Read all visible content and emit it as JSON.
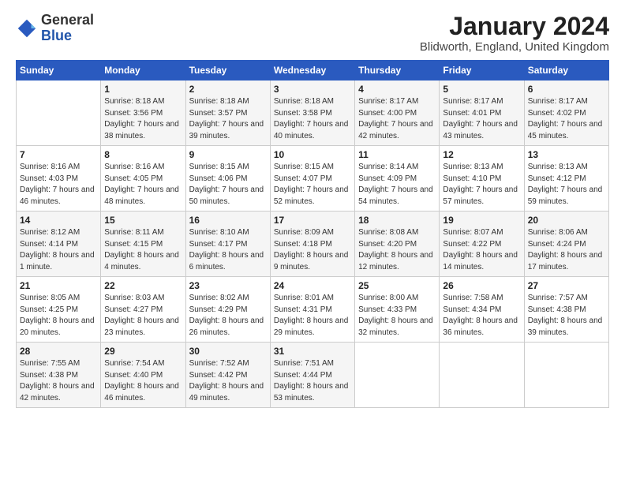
{
  "logo": {
    "text_general": "General",
    "text_blue": "Blue"
  },
  "header": {
    "month_title": "January 2024",
    "location": "Blidworth, England, United Kingdom"
  },
  "days_of_week": [
    "Sunday",
    "Monday",
    "Tuesday",
    "Wednesday",
    "Thursday",
    "Friday",
    "Saturday"
  ],
  "weeks": [
    [
      {
        "day": "",
        "sunrise": "",
        "sunset": "",
        "daylight": ""
      },
      {
        "day": "1",
        "sunrise": "Sunrise: 8:18 AM",
        "sunset": "Sunset: 3:56 PM",
        "daylight": "Daylight: 7 hours and 38 minutes."
      },
      {
        "day": "2",
        "sunrise": "Sunrise: 8:18 AM",
        "sunset": "Sunset: 3:57 PM",
        "daylight": "Daylight: 7 hours and 39 minutes."
      },
      {
        "day": "3",
        "sunrise": "Sunrise: 8:18 AM",
        "sunset": "Sunset: 3:58 PM",
        "daylight": "Daylight: 7 hours and 40 minutes."
      },
      {
        "day": "4",
        "sunrise": "Sunrise: 8:17 AM",
        "sunset": "Sunset: 4:00 PM",
        "daylight": "Daylight: 7 hours and 42 minutes."
      },
      {
        "day": "5",
        "sunrise": "Sunrise: 8:17 AM",
        "sunset": "Sunset: 4:01 PM",
        "daylight": "Daylight: 7 hours and 43 minutes."
      },
      {
        "day": "6",
        "sunrise": "Sunrise: 8:17 AM",
        "sunset": "Sunset: 4:02 PM",
        "daylight": "Daylight: 7 hours and 45 minutes."
      }
    ],
    [
      {
        "day": "7",
        "sunrise": "Sunrise: 8:16 AM",
        "sunset": "Sunset: 4:03 PM",
        "daylight": "Daylight: 7 hours and 46 minutes."
      },
      {
        "day": "8",
        "sunrise": "Sunrise: 8:16 AM",
        "sunset": "Sunset: 4:05 PM",
        "daylight": "Daylight: 7 hours and 48 minutes."
      },
      {
        "day": "9",
        "sunrise": "Sunrise: 8:15 AM",
        "sunset": "Sunset: 4:06 PM",
        "daylight": "Daylight: 7 hours and 50 minutes."
      },
      {
        "day": "10",
        "sunrise": "Sunrise: 8:15 AM",
        "sunset": "Sunset: 4:07 PM",
        "daylight": "Daylight: 7 hours and 52 minutes."
      },
      {
        "day": "11",
        "sunrise": "Sunrise: 8:14 AM",
        "sunset": "Sunset: 4:09 PM",
        "daylight": "Daylight: 7 hours and 54 minutes."
      },
      {
        "day": "12",
        "sunrise": "Sunrise: 8:13 AM",
        "sunset": "Sunset: 4:10 PM",
        "daylight": "Daylight: 7 hours and 57 minutes."
      },
      {
        "day": "13",
        "sunrise": "Sunrise: 8:13 AM",
        "sunset": "Sunset: 4:12 PM",
        "daylight": "Daylight: 7 hours and 59 minutes."
      }
    ],
    [
      {
        "day": "14",
        "sunrise": "Sunrise: 8:12 AM",
        "sunset": "Sunset: 4:14 PM",
        "daylight": "Daylight: 8 hours and 1 minute."
      },
      {
        "day": "15",
        "sunrise": "Sunrise: 8:11 AM",
        "sunset": "Sunset: 4:15 PM",
        "daylight": "Daylight: 8 hours and 4 minutes."
      },
      {
        "day": "16",
        "sunrise": "Sunrise: 8:10 AM",
        "sunset": "Sunset: 4:17 PM",
        "daylight": "Daylight: 8 hours and 6 minutes."
      },
      {
        "day": "17",
        "sunrise": "Sunrise: 8:09 AM",
        "sunset": "Sunset: 4:18 PM",
        "daylight": "Daylight: 8 hours and 9 minutes."
      },
      {
        "day": "18",
        "sunrise": "Sunrise: 8:08 AM",
        "sunset": "Sunset: 4:20 PM",
        "daylight": "Daylight: 8 hours and 12 minutes."
      },
      {
        "day": "19",
        "sunrise": "Sunrise: 8:07 AM",
        "sunset": "Sunset: 4:22 PM",
        "daylight": "Daylight: 8 hours and 14 minutes."
      },
      {
        "day": "20",
        "sunrise": "Sunrise: 8:06 AM",
        "sunset": "Sunset: 4:24 PM",
        "daylight": "Daylight: 8 hours and 17 minutes."
      }
    ],
    [
      {
        "day": "21",
        "sunrise": "Sunrise: 8:05 AM",
        "sunset": "Sunset: 4:25 PM",
        "daylight": "Daylight: 8 hours and 20 minutes."
      },
      {
        "day": "22",
        "sunrise": "Sunrise: 8:03 AM",
        "sunset": "Sunset: 4:27 PM",
        "daylight": "Daylight: 8 hours and 23 minutes."
      },
      {
        "day": "23",
        "sunrise": "Sunrise: 8:02 AM",
        "sunset": "Sunset: 4:29 PM",
        "daylight": "Daylight: 8 hours and 26 minutes."
      },
      {
        "day": "24",
        "sunrise": "Sunrise: 8:01 AM",
        "sunset": "Sunset: 4:31 PM",
        "daylight": "Daylight: 8 hours and 29 minutes."
      },
      {
        "day": "25",
        "sunrise": "Sunrise: 8:00 AM",
        "sunset": "Sunset: 4:33 PM",
        "daylight": "Daylight: 8 hours and 32 minutes."
      },
      {
        "day": "26",
        "sunrise": "Sunrise: 7:58 AM",
        "sunset": "Sunset: 4:34 PM",
        "daylight": "Daylight: 8 hours and 36 minutes."
      },
      {
        "day": "27",
        "sunrise": "Sunrise: 7:57 AM",
        "sunset": "Sunset: 4:38 PM",
        "daylight": "Daylight: 8 hours and 39 minutes."
      }
    ],
    [
      {
        "day": "28",
        "sunrise": "Sunrise: 7:55 AM",
        "sunset": "Sunset: 4:38 PM",
        "daylight": "Daylight: 8 hours and 42 minutes."
      },
      {
        "day": "29",
        "sunrise": "Sunrise: 7:54 AM",
        "sunset": "Sunset: 4:40 PM",
        "daylight": "Daylight: 8 hours and 46 minutes."
      },
      {
        "day": "30",
        "sunrise": "Sunrise: 7:52 AM",
        "sunset": "Sunset: 4:42 PM",
        "daylight": "Daylight: 8 hours and 49 minutes."
      },
      {
        "day": "31",
        "sunrise": "Sunrise: 7:51 AM",
        "sunset": "Sunset: 4:44 PM",
        "daylight": "Daylight: 8 hours and 53 minutes."
      },
      {
        "day": "",
        "sunrise": "",
        "sunset": "",
        "daylight": ""
      },
      {
        "day": "",
        "sunrise": "",
        "sunset": "",
        "daylight": ""
      },
      {
        "day": "",
        "sunrise": "",
        "sunset": "",
        "daylight": ""
      }
    ]
  ]
}
